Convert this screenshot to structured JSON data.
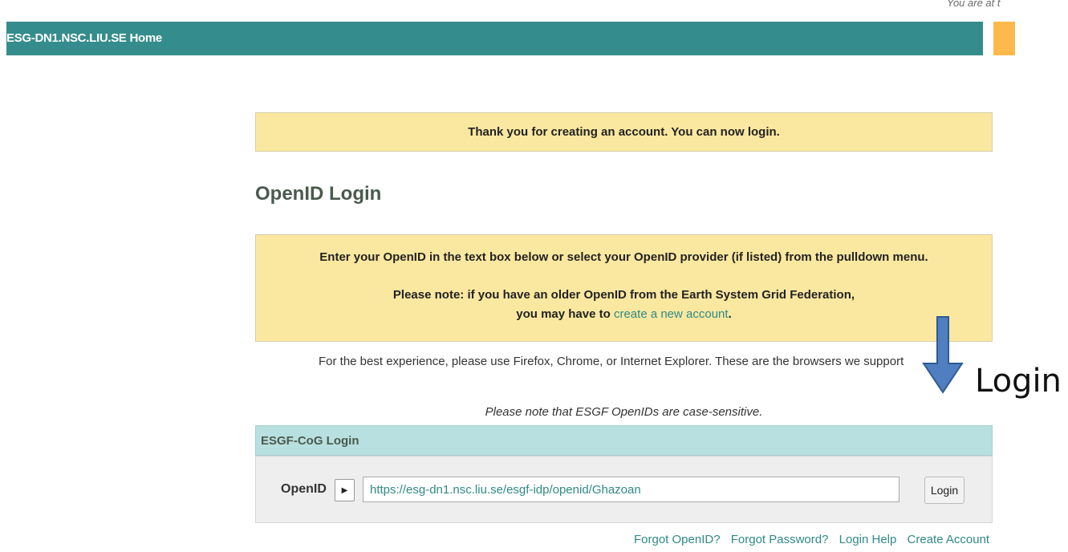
{
  "header": {
    "you_are_at": "You are at t",
    "home_link": "ESG-DN1.NSC.LIU.SE Home"
  },
  "notice": {
    "message": "Thank you for creating an account. You can now login."
  },
  "page_title": "OpenID Login",
  "info_box": {
    "line1": "Enter your OpenID in the text box below or select your OpenID provider (if listed) from the pulldown menu.",
    "line2": "Please note: if you have an older OpenID from the Earth System Grid Federation,",
    "line3_prefix": "you may have to ",
    "line3_link": "create a new account",
    "line3_suffix": "."
  },
  "browser_note": "For the best experience, please use Firefox, Chrome, or Internet Explorer. These are the browsers we support",
  "case_note": "Please note that ESGF OpenIDs are case-sensitive.",
  "login_panel": {
    "title": "ESGF-CoG Login",
    "openid_label": "OpenID",
    "openid_value": "https://esg-dn1.nsc.liu.se/esgf-idp/openid/Ghazoan",
    "login_button": "Login"
  },
  "footer_links": [
    "Forgot OpenID?",
    "Forgot Password?",
    "Login Help",
    "Create Account"
  ],
  "annotation": {
    "label": "Login",
    "arrow_color": "#4f7fc0"
  },
  "colors": {
    "topbar": "#358c8c",
    "notice_bg": "#fbe8a0",
    "link": "#2f8a86",
    "accent_orange": "#fdb94a"
  }
}
